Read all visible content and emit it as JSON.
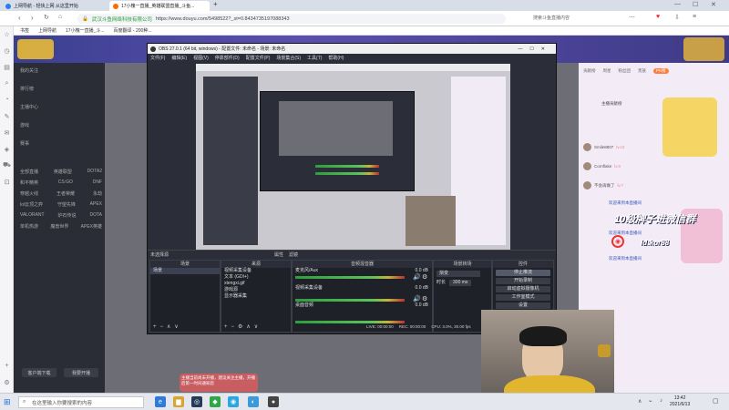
{
  "browser": {
    "tabs": [
      {
        "label": "上网导航 - 轻快上网 从这里开始",
        "active": false
      },
      {
        "label": "17小槐一直播_英雄联盟直播_斗鱼...",
        "active": true
      }
    ],
    "new_tab": "+",
    "site_identity": "武汉斗鱼网络科技有限公司",
    "url": "https://www.douyu.com/5498522?_st=0.8434735197088343",
    "address_hint": "搜索斗鱼直播内容",
    "bookmarks": [
      "书签",
      "上网导航",
      "17小槐一直播_斗...",
      "百度翻译 - 200种..."
    ]
  },
  "sidebar": {
    "items": [
      "我的关注",
      "排行榜",
      "主播中心",
      "游戏",
      "赛事"
    ],
    "categories": [
      [
        "全部直播",
        "英雄联盟",
        "DOTA2"
      ],
      [
        "和平精英",
        "CS:GO",
        "DNF"
      ],
      [
        "穿越火线",
        "王者荣耀",
        "永劫"
      ],
      [
        "lol云顶之弈",
        "守望先锋",
        "APEX"
      ],
      [
        "VALORANT",
        "炉石传说",
        "DOTA"
      ],
      [
        "单机热游",
        "魔兽世界",
        "APEX英雄"
      ]
    ],
    "bottom_buttons": [
      "客户端下载",
      "我要开播"
    ]
  },
  "obs": {
    "title": "OBS 27.0.1 (64 bit, windows) - 配置文件: 未命名 - 场景: 未命名",
    "menu": [
      "文件(F)",
      "编辑(E)",
      "视图(V)",
      "停靠部件(D)",
      "配置文件(P)",
      "场景集合(S)",
      "工具(T)",
      "帮助(H)"
    ],
    "preview_label": "未选择源",
    "status_items": [
      "属性",
      "滤镜"
    ],
    "docks": {
      "scenes": {
        "title": "场景",
        "items": [
          "场景"
        ]
      },
      "sources": {
        "title": "来源",
        "items": [
          "视频采集设备",
          "文本 (GDI+)",
          "xtengxi.gif",
          "游戏源",
          "显示器采集"
        ]
      },
      "mixer": {
        "title": "音频混音器",
        "channels": [
          {
            "name": "麦克风/Aux",
            "db": "0.0 dB"
          },
          {
            "name": "视频采集设备",
            "db": "0.0 dB"
          },
          {
            "name": "桌面音频",
            "db": "0.0 dB"
          }
        ]
      },
      "transitions": {
        "title": "场景转场",
        "type": "渐变",
        "duration_label": "时长",
        "duration": "300 ms"
      },
      "controls": {
        "title": "控件",
        "buttons": [
          "停止推流",
          "开始录制",
          "启动虚拟摄像机",
          "工作室模式",
          "设置"
        ]
      }
    },
    "statusbar": {
      "live": "LIVE: 00:00:00",
      "rec": "REC: 00:00:00",
      "cpu": "CPU: 3.0%, 30.00 fps"
    }
  },
  "chat": {
    "header_actions": [
      "贡献榜",
      "周星",
      "粉丝团",
      "贵族",
      "PK榜"
    ],
    "rank_title": "主播贡献榜",
    "lines": [
      {
        "user": "Smile8807",
        "level": "lv.10"
      },
      {
        "user": "Cornflake",
        "level": "lv.9"
      },
      {
        "user": "不会再做了",
        "level": "lv.7"
      }
    ],
    "system_messages": [
      "欢迎来到本直播间",
      "欢迎来到本直播间",
      "欢迎来到本直播间"
    ]
  },
  "overlay": {
    "wechat_text": "10级牌子进微信群",
    "id_text": "Id:kor88",
    "notice": "主播当前尚未开播，建议关注主播，开播后第一时间通知您"
  },
  "taskbar": {
    "search_placeholder": "在这里输入你要搜索的内容",
    "time": "13:42",
    "date": "2021/6/13"
  },
  "colors": {
    "douyu_header": "#4b47a3",
    "obs_bg": "#2b2e38",
    "stop_stream_btn": "#3a3d48",
    "overlay_text": "#ffffff"
  }
}
